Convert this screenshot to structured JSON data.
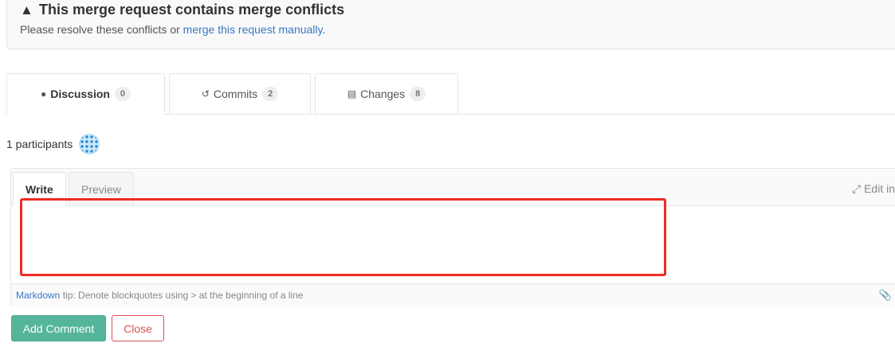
{
  "alert": {
    "title": "This merge request contains merge conflicts",
    "text_before": "Please resolve these conflicts or ",
    "link": "merge this request manually",
    "text_after": "."
  },
  "tabs": [
    {
      "label": "Discussion",
      "count": "0",
      "icon": "comments-icon",
      "active": true
    },
    {
      "label": "Commits",
      "count": "2",
      "icon": "history-icon",
      "active": false
    },
    {
      "label": "Changes",
      "count": "8",
      "icon": "list-icon",
      "active": false
    }
  ],
  "participants": {
    "label": "1 participants"
  },
  "editor": {
    "write_tab": "Write",
    "preview_tab": "Preview",
    "fullscreen_label": "Edit in",
    "textarea_value": "",
    "tip_link": "Markdown",
    "tip_text": " tip: Denote blockquotes using > at the beginning of a line"
  },
  "buttons": {
    "add_comment": "Add Comment",
    "close": "Close"
  },
  "colors": {
    "accent_green": "#55b59a",
    "danger_red": "#d9534f",
    "link_blue": "#3a77c4",
    "highlight_red": "#ee2a24"
  }
}
